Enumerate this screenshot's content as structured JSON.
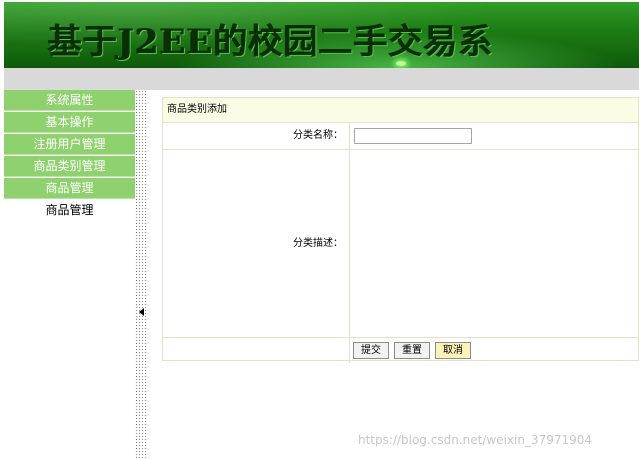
{
  "header": {
    "title": "基于J2EE的校园二手交易系"
  },
  "sidebar": {
    "items": [
      {
        "label": "系统属性"
      },
      {
        "label": "基本操作"
      },
      {
        "label": "注册用户管理"
      },
      {
        "label": "商品类别管理"
      },
      {
        "label": "商品管理"
      }
    ],
    "sub_item": "商品管理"
  },
  "form": {
    "title": "商品类别添加",
    "name_label": "分类名称：",
    "name_value": "",
    "desc_label": "分类描述：",
    "submit_label": "提交",
    "reset_label": "重置",
    "cancel_label": "取消"
  },
  "watermark": "https://blog.csdn.net/weixin_37971904"
}
